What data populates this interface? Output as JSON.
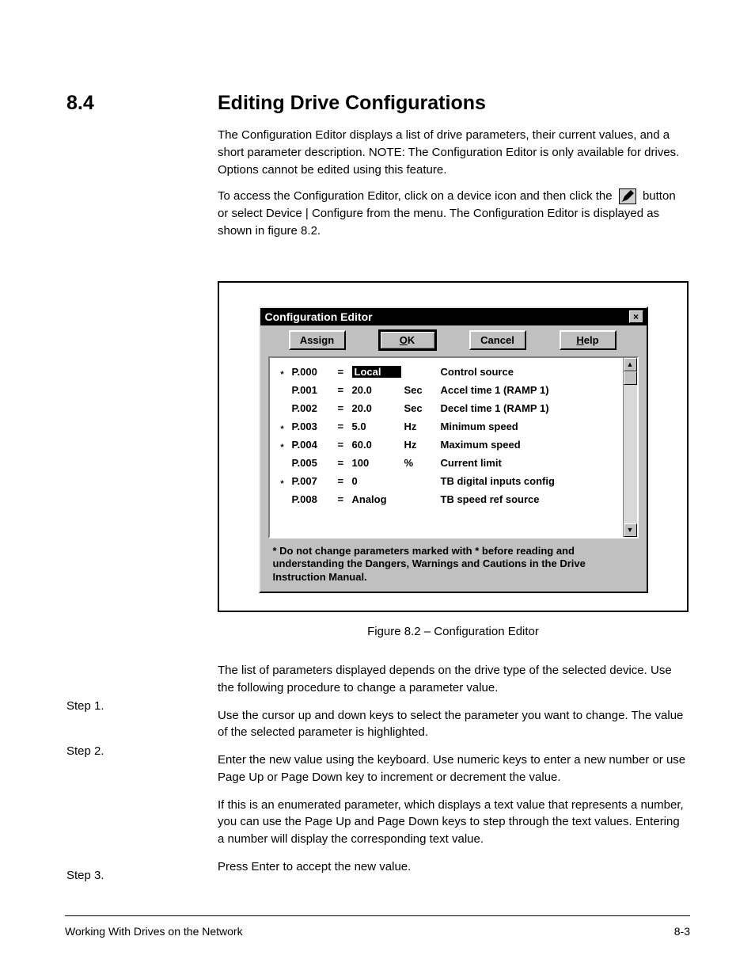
{
  "section": {
    "number": "8.4",
    "title": "Editing Drive Configurations"
  },
  "intro": {
    "p1": "The Configuration Editor displays a list of drive parameters, their current values, and a short parameter description. NOTE: The Configuration Editor is only available for drives. Options cannot be edited using this feature.",
    "p2_a": "To access the Configuration Editor, click on a device icon and then click the ",
    "p2_b": " button or select Device | Configure from the menu. The Configuration Editor is displayed as shown in figure 8.2.",
    "inline_icon_name": "pencil-icon"
  },
  "dialog": {
    "title": "Configuration Editor",
    "buttons": {
      "assign": "Assign",
      "assign_ul": "g",
      "ok_ul": "O",
      "ok": "K",
      "cancel": "Cancel",
      "help_ul": "H",
      "help": "elp"
    },
    "rows": [
      {
        "star": "*",
        "param": "P.000",
        "eq": "=",
        "value": "Local",
        "unit": "",
        "desc": "Control source",
        "selected": true
      },
      {
        "star": "",
        "param": "P.001",
        "eq": "=",
        "value": "20.0",
        "unit": "Sec",
        "desc": "Accel time 1 (RAMP 1)",
        "selected": false
      },
      {
        "star": "",
        "param": "P.002",
        "eq": "=",
        "value": "20.0",
        "unit": "Sec",
        "desc": "Decel time 1 (RAMP 1)",
        "selected": false
      },
      {
        "star": "*",
        "param": "P.003",
        "eq": "=",
        "value": "5.0",
        "unit": "Hz",
        "desc": "Minimum speed",
        "selected": false
      },
      {
        "star": "*",
        "param": "P.004",
        "eq": "=",
        "value": "60.0",
        "unit": "Hz",
        "desc": "Maximum speed",
        "selected": false
      },
      {
        "star": "",
        "param": "P.005",
        "eq": "=",
        "value": "100",
        "unit": "%",
        "desc": "Current limit",
        "selected": false
      },
      {
        "star": "*",
        "param": "P.007",
        "eq": "=",
        "value": "0",
        "unit": "",
        "desc": "TB digital inputs config",
        "selected": false
      },
      {
        "star": "",
        "param": "P.008",
        "eq": "=",
        "value": "Analog",
        "unit": "",
        "desc": "TB speed ref source",
        "selected": false
      }
    ],
    "warning": "* Do not change parameters marked with * before reading and understanding the Dangers, Warnings and Cautions in the Drive Instruction Manual."
  },
  "figure_caption": "Figure 8.2 – Configuration Editor",
  "lower": {
    "p1": "The list of parameters displayed depends on the drive type of the selected device. Use the following procedure to change a parameter value.",
    "step1_label": "Step 1.",
    "step1_text": "Use the cursor up and down keys to select the parameter you want to change. The value of the selected parameter is highlighted.",
    "step2_label": "Step 2.",
    "step2_text": "Enter the new value using the keyboard. Use numeric keys to enter a new number or use Page Up or Page Down key to increment or decrement the value.",
    "step2_text_b": "If this is an enumerated parameter, which displays a text value that represents a number, you can use the Page Up and Page Down keys to step through the text values. Entering a number will display the corresponding text value.",
    "step3_label": "Step 3.",
    "step3_text": "Press Enter to accept the new value."
  },
  "footer": {
    "left": "Working With Drives on the Network",
    "right": "8-3"
  }
}
